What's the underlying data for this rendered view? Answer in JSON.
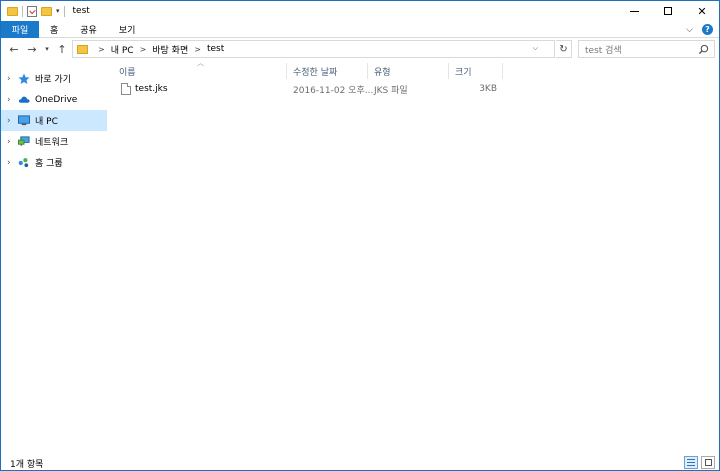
{
  "window": {
    "title": "test"
  },
  "ribbon": {
    "tabs": [
      "파일",
      "홈",
      "공유",
      "보기"
    ]
  },
  "navigation": {
    "breadcrumb": [
      "내 PC",
      "바탕 화면",
      "test"
    ]
  },
  "search": {
    "placeholder": "test 검색"
  },
  "sidebar": {
    "items": [
      {
        "label": "바로 가기",
        "icon": "star-icon"
      },
      {
        "label": "OneDrive",
        "icon": "cloud-icon"
      },
      {
        "label": "내 PC",
        "icon": "computer-icon",
        "selected": true
      },
      {
        "label": "네트워크",
        "icon": "network-icon"
      },
      {
        "label": "홈 그룹",
        "icon": "homegroup-icon"
      }
    ]
  },
  "files": {
    "columns": [
      "이름",
      "수정한 날짜",
      "유형",
      "크기"
    ],
    "rows": [
      {
        "name": "test.jks",
        "modified": "2016-11-02 오후...",
        "type": "JKS 파일",
        "size": "3KB"
      }
    ]
  },
  "status": {
    "item_count": "1개 항목"
  },
  "colors": {
    "accent": "#1979ca",
    "selection": "#cce8ff",
    "header_text": "#4c607a"
  }
}
